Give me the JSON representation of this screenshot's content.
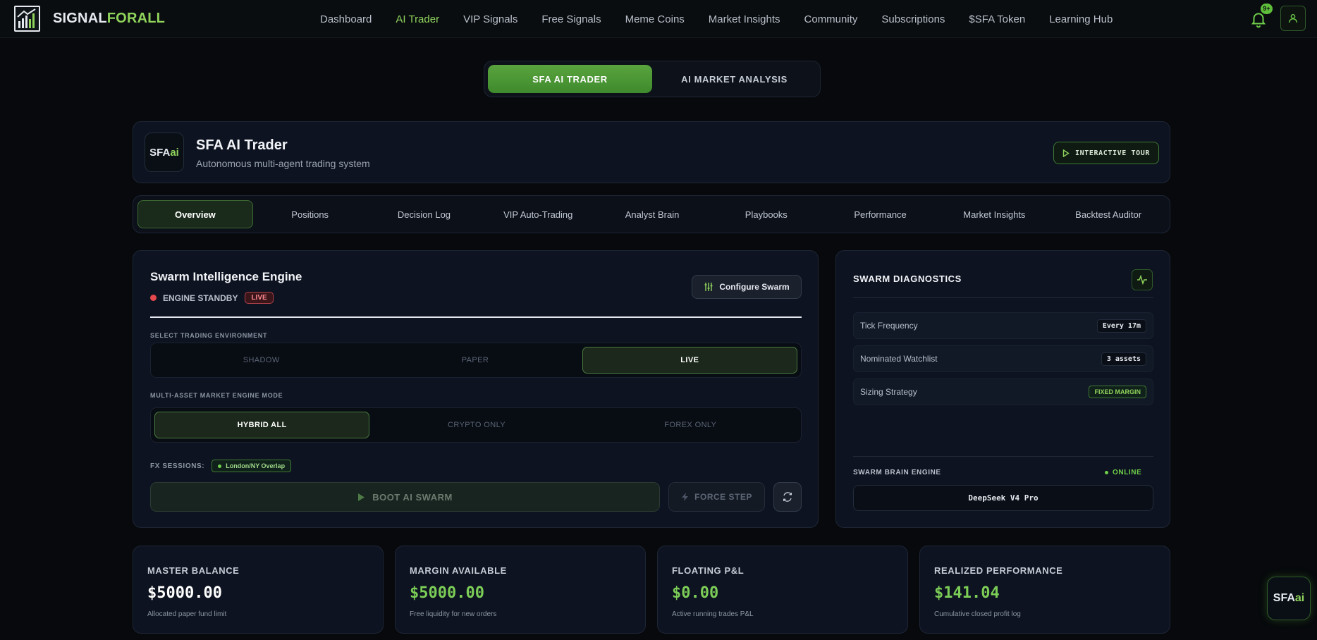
{
  "brand": {
    "name_part1": "SIGNAL",
    "name_part2": "FORALL"
  },
  "nav": {
    "links": [
      "Dashboard",
      "AI Trader",
      "VIP Signals",
      "Free Signals",
      "Meme Coins",
      "Market Insights",
      "Community",
      "Subscriptions",
      "$SFA Token",
      "Learning Hub"
    ],
    "active": "AI Trader",
    "notification_badge": "9+"
  },
  "mode_switch": {
    "options": [
      "SFA AI TRADER",
      "AI MARKET ANALYSIS"
    ],
    "active": "SFA AI TRADER"
  },
  "header": {
    "logo_part1": "SFA",
    "logo_part2": "ai",
    "title": "SFA AI Trader",
    "subtitle": "Autonomous multi-agent trading system",
    "tour_button": "INTERACTIVE TOUR"
  },
  "tabs": {
    "items": [
      "Overview",
      "Positions",
      "Decision Log",
      "VIP Auto-Trading",
      "Analyst Brain",
      "Playbooks",
      "Performance",
      "Market Insights",
      "Backtest Auditor"
    ],
    "active": "Overview"
  },
  "engine": {
    "title": "Swarm Intelligence Engine",
    "status": "ENGINE STANDBY",
    "status_pill": "LIVE",
    "configure_button": "Configure Swarm",
    "env_label": "SELECT TRADING ENVIRONMENT",
    "env_options": [
      "SHADOW",
      "PAPER",
      "LIVE"
    ],
    "env_active": "LIVE",
    "mode_label": "MULTI-ASSET MARKET ENGINE MODE",
    "mode_options": [
      "HYBRID ALL",
      "CRYPTO ONLY",
      "FOREX ONLY"
    ],
    "mode_active": "HYBRID ALL",
    "fx_label": "FX SESSIONS:",
    "fx_session": "London/NY Overlap",
    "boot_button": "BOOT AI SWARM",
    "force_button": "FORCE STEP"
  },
  "diagnostics": {
    "title": "SWARM DIAGNOSTICS",
    "rows": [
      {
        "name": "Tick Frequency",
        "value": "Every 17m"
      },
      {
        "name": "Nominated Watchlist",
        "value": "3 assets"
      },
      {
        "name": "Sizing Strategy",
        "value": "FIXED MARGIN"
      }
    ],
    "brain_label": "SWARM BRAIN ENGINE",
    "brain_status": "ONLINE",
    "model": "DeepSeek V4 Pro"
  },
  "metrics": [
    {
      "label": "MASTER BALANCE",
      "value": "$5000.00",
      "sub": "Allocated paper fund limit"
    },
    {
      "label": "MARGIN AVAILABLE",
      "value": "$5000.00",
      "sub": "Free liquidity for new orders"
    },
    {
      "label": "FLOATING P&L",
      "value": "$0.00",
      "sub": "Active running trades P&L"
    },
    {
      "label": "REALIZED PERFORMANCE",
      "value": "$141.04",
      "sub": "Cumulative closed profit log"
    }
  ],
  "float_logo": {
    "part1": "SFA",
    "part2": "ai"
  },
  "colors": {
    "accent": "#5fbf3a",
    "accent_text": "#8fd35b",
    "background": "#07090c",
    "card": "#0d1320",
    "danger": "#e5484d"
  }
}
